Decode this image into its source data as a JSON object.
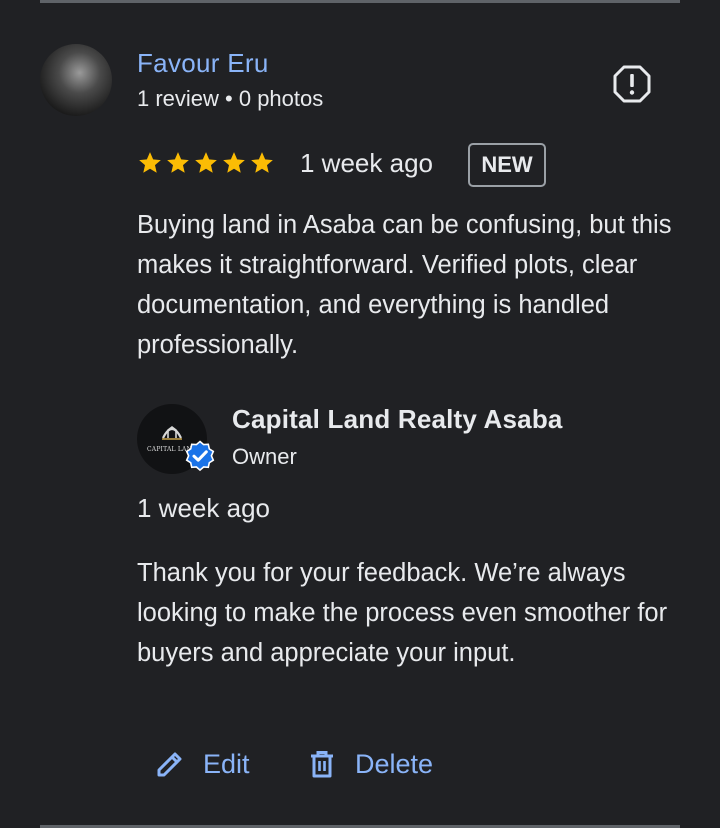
{
  "review": {
    "reviewer_name": "Favour Eru",
    "reviewer_meta": "1 review • 0 photos",
    "rating": 5,
    "time": "1 week ago",
    "badge": "NEW",
    "text": "Buying land in Asaba can be confusing, but this makes it straightforward. Verified plots, clear documentation, and everything is handled professionally."
  },
  "reply": {
    "owner_name": "Capital Land Realty Asaba",
    "owner_role": "Owner",
    "logo_text": "CAPITAL LAND",
    "time": "1 week ago",
    "text": "Thank you for your feedback. We’re always looking to make the process even smoother for buyers and appreciate your input."
  },
  "actions": {
    "edit_label": "Edit",
    "delete_label": "Delete"
  },
  "icons": {
    "report": "report-icon",
    "star": "star-icon",
    "verified": "verified-badge-icon",
    "edit": "pencil-icon",
    "delete": "trash-icon"
  },
  "colors": {
    "background": "#202124",
    "link": "#8ab4f8",
    "star": "#fbbc04",
    "text": "#e8eaed",
    "verified": "#1a73e8"
  }
}
